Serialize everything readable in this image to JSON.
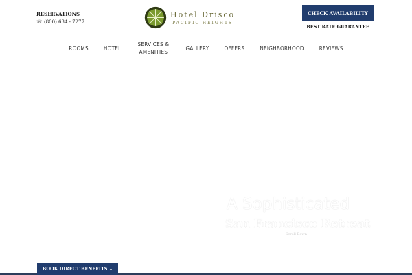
{
  "header": {
    "reservations_label": "RESERVATIONS",
    "phone": "(800) 634 - 7277",
    "hotel_name": "Hotel Drisco",
    "hotel_subtitle": "PACIFIC HEIGHTS",
    "check_availability": "CHECK AVAILABILITY",
    "best_rate": "BEST RATE GUARANTEE",
    "logo_color": "#556b2f"
  },
  "nav": {
    "items": [
      {
        "label": "ROOMS"
      },
      {
        "label": "HOTEL"
      },
      {
        "label": "SERVICES & AMENITIES"
      },
      {
        "label": "GALLERY"
      },
      {
        "label": "OFFERS"
      },
      {
        "label": "NEIGHBORHOOD"
      },
      {
        "label": "REVIEWS"
      }
    ]
  },
  "hero": {
    "line1": "A Sophisticated",
    "line2": "San Francisco Retreat",
    "scroll": "Scroll Down"
  },
  "footer_tab": {
    "label": "BOOK DIRECT BENEFITS",
    "icon": "chevron-down-icon"
  }
}
